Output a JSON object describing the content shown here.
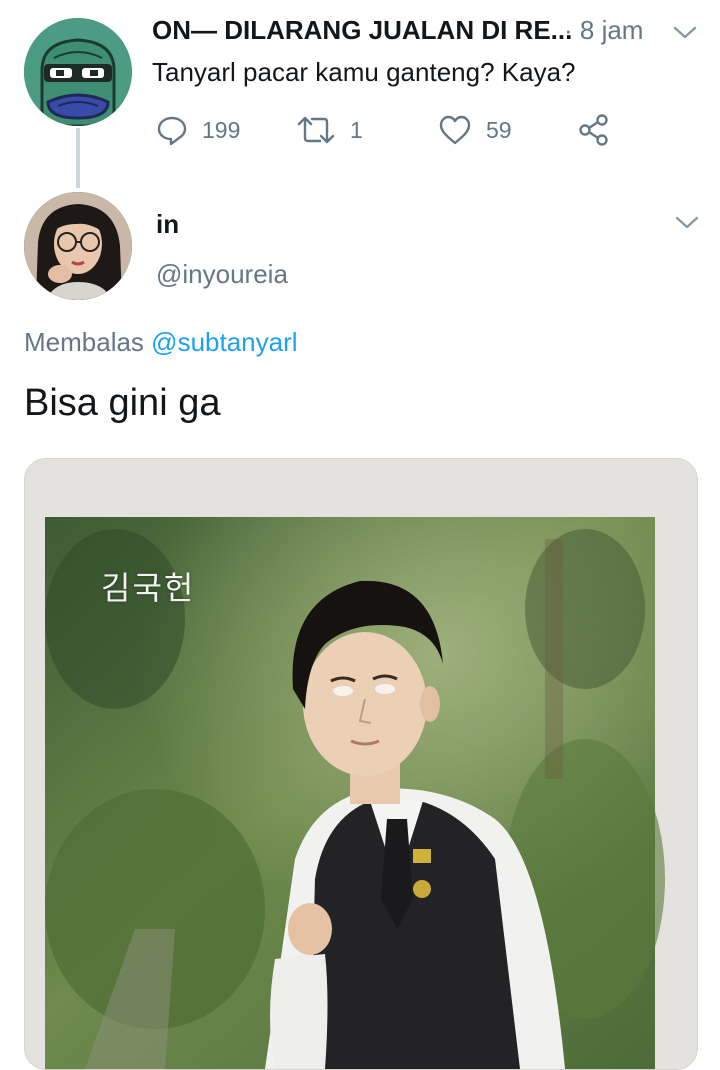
{
  "parent_tweet": {
    "display_name": "ON— DILARANG JUALAN DI RE...",
    "time": "· 8 jam",
    "text": "Tanyarl pacar kamu ganteng? Kaya?",
    "avatar_icon": "frog-avatar",
    "actions": {
      "reply_count": "199",
      "retweet_count": "1",
      "like_count": "59"
    }
  },
  "reply_tweet": {
    "display_name": "in",
    "handle": "@inyoureia",
    "replying_to_prefix": "Membalas",
    "replying_to_handle": "@subtanyarl",
    "text": "Bisa gini ga",
    "media": {
      "korean_name": "김국헌"
    }
  },
  "colors": {
    "text": "#14171a",
    "muted": "#657786",
    "link": "#1da1f2",
    "thread_line": "#ccd6dd"
  }
}
